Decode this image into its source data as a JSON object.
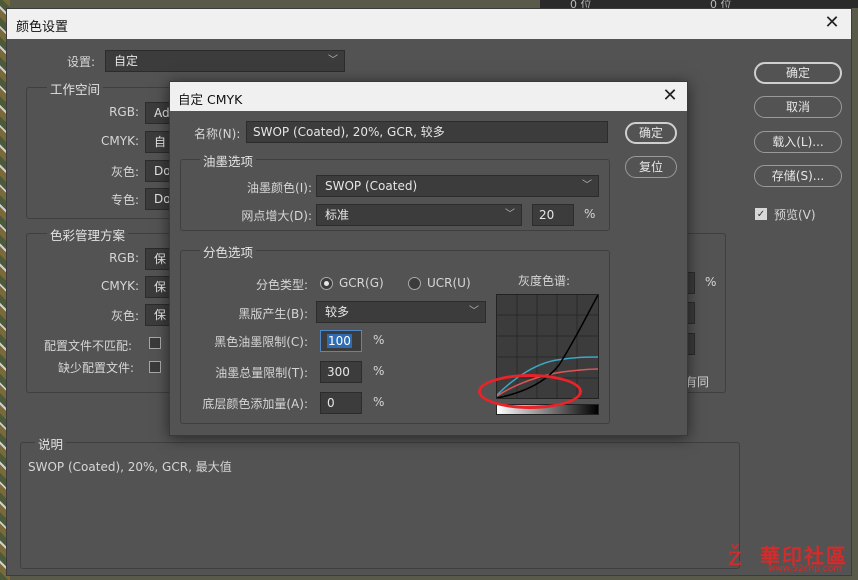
{
  "main": {
    "title": "颜色设置",
    "settings_label": "设置:",
    "settings_value": "自定",
    "working_spaces_title": "工作空间",
    "ws_rgb_label": "RGB:",
    "ws_rgb_value": "Ad",
    "ws_cmyk_label": "CMYK:",
    "ws_cmyk_value": "自",
    "ws_gray_label": "灰色:",
    "ws_gray_value": "Do",
    "ws_spot_label": "专色:",
    "ws_spot_value": "Do",
    "policies_title": "色彩管理方案",
    "pol_rgb_label": "RGB:",
    "pol_rgb_value": "保",
    "pol_cmyk_label": "CMYK:",
    "pol_cmyk_value": "保",
    "pol_gray_label": "灰色:",
    "pol_gray_value": "保",
    "mismatch_label": "配置文件不匹配:",
    "missing_label": "缺少配置文件:",
    "percent_sign": "%",
    "right_fragment": "有同",
    "description_title": "说明",
    "description_text": "SWOP (Coated), 20%, GCR, 最大值",
    "buttons": {
      "ok": "确定",
      "cancel": "取消",
      "load": "载入(L)...",
      "save": "存储(S)...",
      "preview": "预览(V)"
    },
    "preview_checked": true
  },
  "sub": {
    "title": "自定 CMYK",
    "name_label": "名称(N):",
    "name_value": "SWOP (Coated), 20%, GCR, 较多",
    "ok": "确定",
    "reset": "复位",
    "ink_options_title": "油墨选项",
    "ink_colors_label": "油墨颜色(I):",
    "ink_colors_value": "SWOP (Coated)",
    "dot_gain_label": "网点增大(D):",
    "dot_gain_value": "标准",
    "dot_gain_amount": "20",
    "percent_sign": "%",
    "separation_title": "分色选项",
    "sep_type_label": "分色类型:",
    "gcr_label": "GCR(G)",
    "ucr_label": "UCR(U)",
    "gcr_selected": true,
    "gray_ramp_label": "灰度色谱:",
    "black_gen_label": "黑版产生(B):",
    "black_gen_value": "较多",
    "black_ink_limit_label": "黑色油墨限制(C):",
    "black_ink_limit_value": "100",
    "total_ink_limit_label": "油墨总量限制(T):",
    "total_ink_limit_value": "300",
    "ucr_amount_label": "底层颜色添加量(A):",
    "ucr_amount_value": "0"
  },
  "colors": {
    "curve_black": "#000000",
    "curve_cyan": "#3aa8c8",
    "curve_red": "#e05555",
    "annotation_red": "#e8232a"
  },
  "watermark": {
    "text": "華印社區",
    "url": "www.52cnp.com"
  },
  "background": {
    "top_cell_1": "0 位",
    "top_cell_2": "0 位"
  }
}
